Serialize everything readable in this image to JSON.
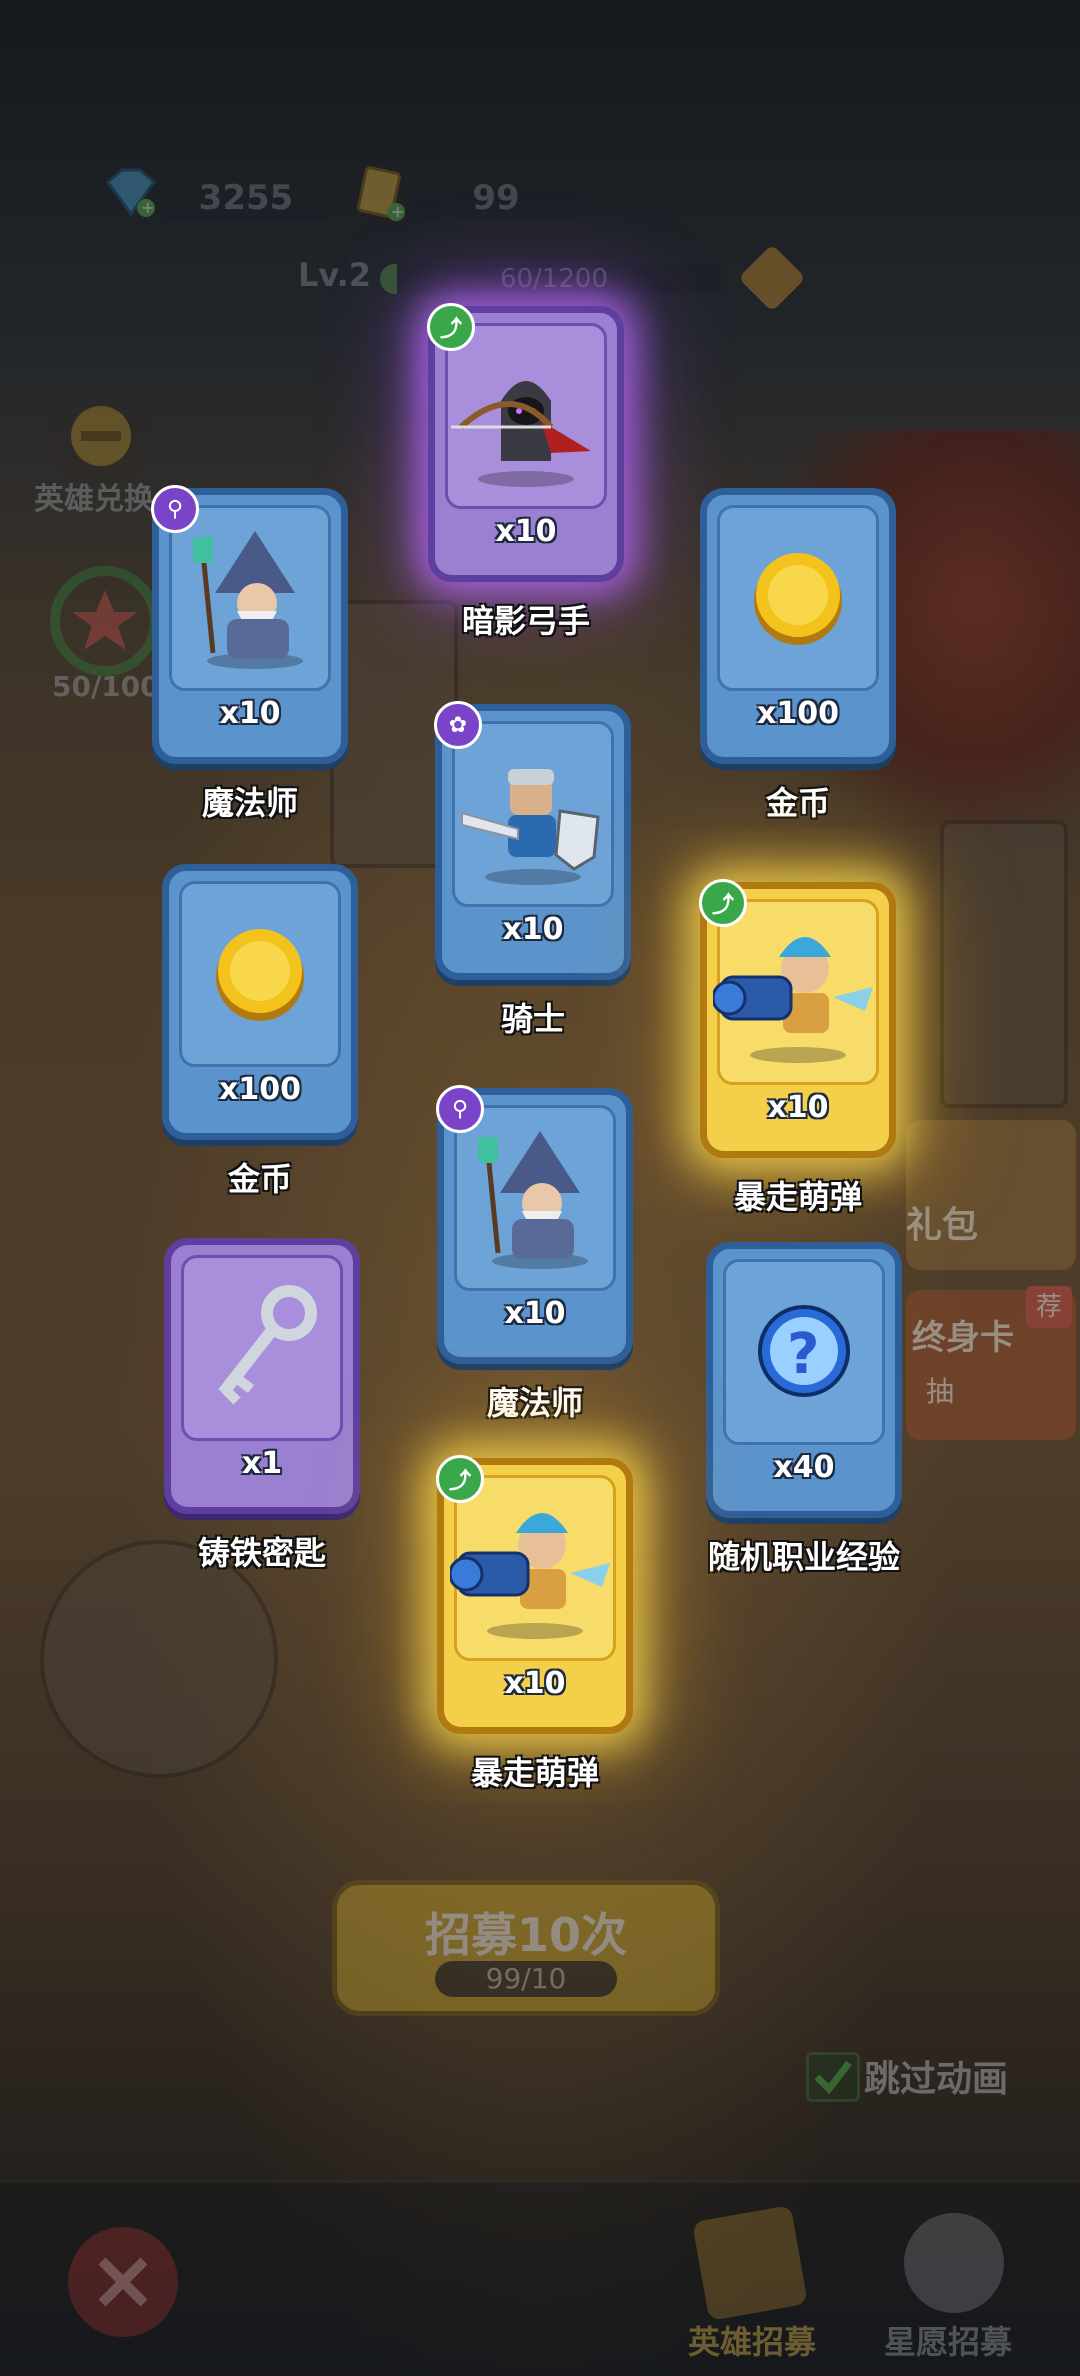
{
  "currencies": {
    "gems": "3255",
    "tickets": "99"
  },
  "level": {
    "label": "Lv.2",
    "progress_text": "60/1200",
    "progress": 0.05
  },
  "left_side": {
    "hero_exchange_label": "英雄兑换",
    "collection_progress": "50/100"
  },
  "cards": [
    {
      "name": "暗影弓手",
      "qty": "x10",
      "rarity": "purple",
      "glow": true,
      "badge": "bow",
      "icon": "shadow-archer-icon"
    },
    {
      "name": "魔法师",
      "qty": "x10",
      "rarity": "blue",
      "glow": false,
      "badge": "wand",
      "icon": "wizard-icon"
    },
    {
      "name": "金币",
      "qty": "x100",
      "rarity": "blue",
      "glow": false,
      "badge": "",
      "icon": "gold-coin-icon"
    },
    {
      "name": "骑士",
      "qty": "x10",
      "rarity": "blue",
      "glow": false,
      "badge": "paw",
      "icon": "knight-icon"
    },
    {
      "name": "金币",
      "qty": "x100",
      "rarity": "blue",
      "glow": false,
      "badge": "",
      "icon": "gold-coin-icon"
    },
    {
      "name": "暴走萌弹",
      "qty": "x10",
      "rarity": "gold",
      "glow": true,
      "badge": "bow",
      "icon": "cannon-gunner-icon"
    },
    {
      "name": "魔法师",
      "qty": "x10",
      "rarity": "blue",
      "glow": false,
      "badge": "wand",
      "icon": "wizard-icon"
    },
    {
      "name": "铸铁密匙",
      "qty": "x1",
      "rarity": "purple",
      "glow": false,
      "badge": "",
      "icon": "iron-key-icon"
    },
    {
      "name": "随机职业经验",
      "qty": "x40",
      "rarity": "blue",
      "glow": false,
      "badge": "",
      "icon": "question-orb-icon"
    },
    {
      "name": "暴走萌弹",
      "qty": "x10",
      "rarity": "gold",
      "glow": true,
      "badge": "bow",
      "icon": "cannon-gunner-icon"
    }
  ],
  "right_side": {
    "pack_label": "礼包",
    "lifetime_card_label": "终身卡",
    "lifetime_sub": "抽",
    "recommend_tag": "荐"
  },
  "recruit": {
    "button_label": "招募10次",
    "cost": "99/10"
  },
  "skip_animation": {
    "label": "跳过动画",
    "checked": true
  },
  "bottom_nav": {
    "hero_recruit": "英雄招募",
    "star_wish_recruit": "星愿招募"
  },
  "colors": {
    "blue_card": "#5b93cc",
    "purple_card": "#9b7fd0",
    "gold_card": "#f3cf4a",
    "badge_green": "#3aa84a",
    "badge_purple": "#7a44c8"
  }
}
